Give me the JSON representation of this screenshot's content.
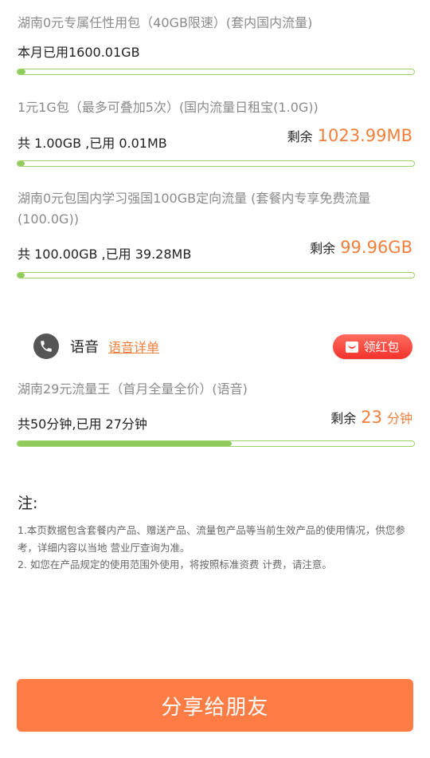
{
  "packages": [
    {
      "title": "湖南0元专属任性用包（40GB限速）(套内国内流量)",
      "used_text": "本月已用1600.01GB",
      "progress": 0.02
    },
    {
      "title": "1元1G包（最多可叠加5次）(国内流量日租宝(1.0G))",
      "used_text": "共 1.00GB ,已用 0.01MB",
      "remain_label": "剩余",
      "remain_value": "1023.99MB",
      "progress": 0.01
    },
    {
      "title": "湖南0元包国内学习强国100GB定向流量 (套餐内专享免费流量(100.0G))",
      "used_text": "共 100.00GB ,已用 39.28MB",
      "remain_label": "剩余",
      "remain_value": "99.96GB",
      "progress": 0.01
    }
  ],
  "voice": {
    "icon": "phone-icon",
    "label": "语音",
    "detail_link": "语音详单",
    "redpacket_button": "领红包",
    "package": {
      "title": "湖南29元流量王（首月全量全价）(语音)",
      "used_text": "共50分钟,已用 27分钟",
      "remain_label": "剩余",
      "remain_value": "23",
      "remain_unit": "分钟",
      "progress": 0.54
    }
  },
  "notes": {
    "title": "注:",
    "lines": [
      "1.本页数据包含套餐内产品、赠送产品、流量包产品等当前生效产品的使用情况，供您参考，详细内容以当地 营业厅查询为准。",
      "2. 如您在产品规定的使用范围外使用，将按照标准资费 计费，请注意。"
    ]
  },
  "share_button": "分享给朋友",
  "colors": {
    "accent": "#f07f3c",
    "bar": "#8fcb58",
    "button": "#ff7c45",
    "redpack": "#f3322b"
  }
}
